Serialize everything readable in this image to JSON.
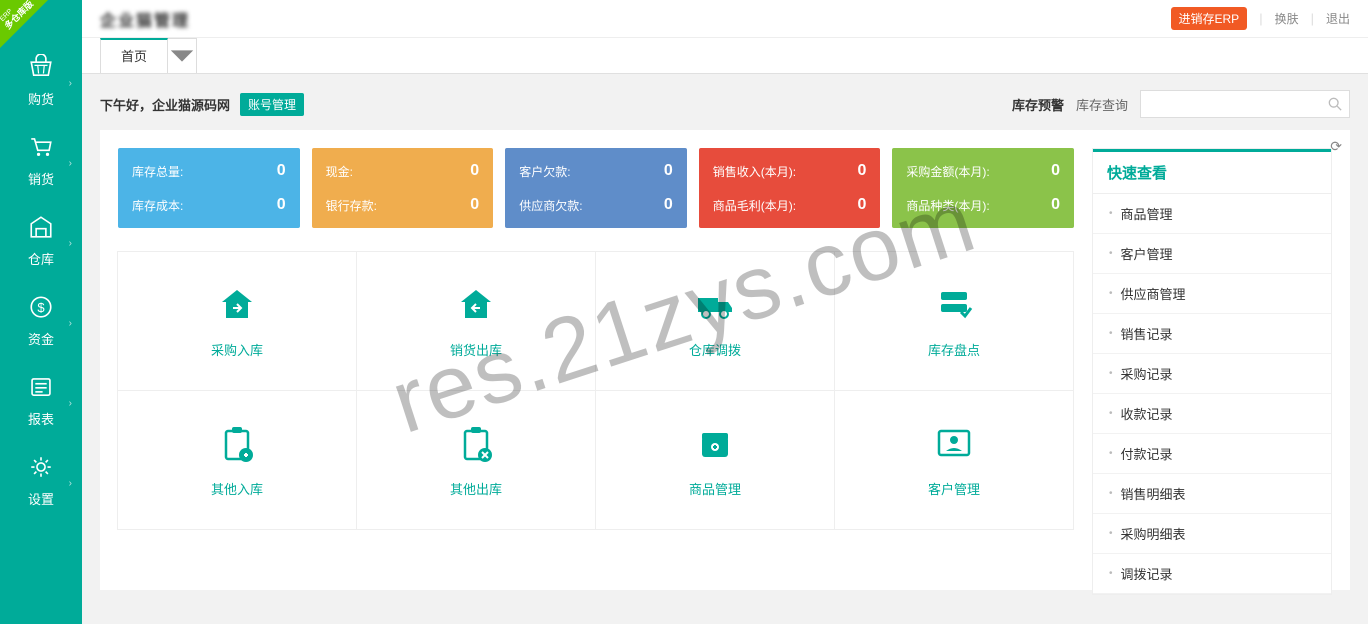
{
  "corner": {
    "main": "多仓库版",
    "sub": "ERP"
  },
  "sidebar": [
    {
      "label": "购货",
      "icon": "basket"
    },
    {
      "label": "销货",
      "icon": "cart"
    },
    {
      "label": "仓库",
      "icon": "warehouse"
    },
    {
      "label": "资金",
      "icon": "money"
    },
    {
      "label": "报表",
      "icon": "report"
    },
    {
      "label": "设置",
      "icon": "gear"
    }
  ],
  "logoBlur": "企业猫管理",
  "topRight": {
    "erp": "进销存ERP",
    "skin": "换肤",
    "logout": "退出"
  },
  "tabs": {
    "home": "首页"
  },
  "greeting": "下午好，企业猫源码网",
  "acctMgmt": "账号管理",
  "stockAlert": "库存预警",
  "stockQuery": "库存查询",
  "cards": [
    {
      "rows": [
        {
          "label": "库存总量:",
          "val": "0"
        },
        {
          "label": "库存成本:",
          "val": "0"
        }
      ]
    },
    {
      "rows": [
        {
          "label": "现金:",
          "val": "0"
        },
        {
          "label": "银行存款:",
          "val": "0"
        }
      ]
    },
    {
      "rows": [
        {
          "label": "客户欠款:",
          "val": "0"
        },
        {
          "label": "供应商欠款:",
          "val": "0"
        }
      ]
    },
    {
      "rows": [
        {
          "label": "销售收入(本月):",
          "val": "0"
        },
        {
          "label": "商品毛利(本月):",
          "val": "0"
        }
      ]
    },
    {
      "rows": [
        {
          "label": "采购金额(本月):",
          "val": "0"
        },
        {
          "label": "商品种类(本月):",
          "val": "0"
        }
      ]
    }
  ],
  "quick": [
    {
      "label": "采购入库",
      "icon": "house-in"
    },
    {
      "label": "销货出库",
      "icon": "house-out"
    },
    {
      "label": "仓库调拨",
      "icon": "truck"
    },
    {
      "label": "库存盘点",
      "icon": "checklist"
    },
    {
      "label": "其他入库",
      "icon": "clip-in"
    },
    {
      "label": "其他出库",
      "icon": "clip-out"
    },
    {
      "label": "商品管理",
      "icon": "box"
    },
    {
      "label": "客户管理",
      "icon": "person"
    }
  ],
  "rightPanel": {
    "title": "快速查看",
    "items": [
      "商品管理",
      "客户管理",
      "供应商管理",
      "销售记录",
      "采购记录",
      "收款记录",
      "付款记录",
      "销售明细表",
      "采购明细表",
      "调拨记录"
    ]
  },
  "watermark": "res.21zys.com"
}
